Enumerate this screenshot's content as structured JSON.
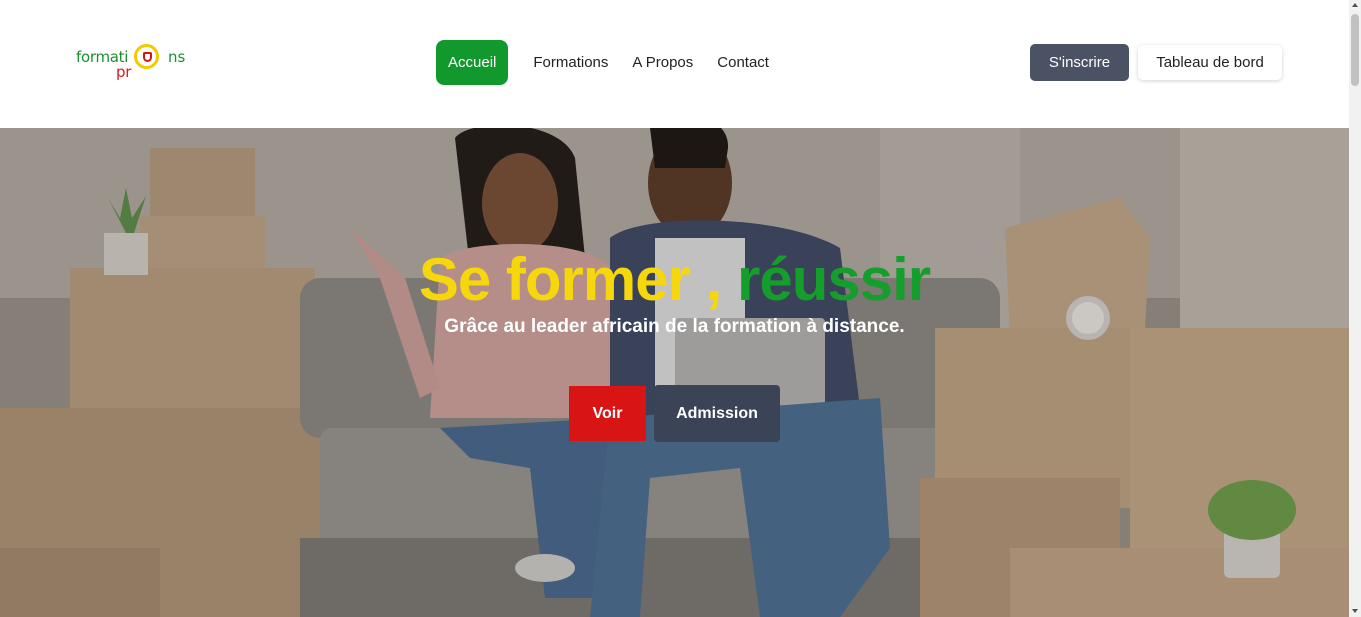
{
  "header": {
    "logo": {
      "line1": "formati",
      "line1_end": "ns",
      "line2": "pr"
    },
    "nav": [
      {
        "label": "Accueil",
        "active": true
      },
      {
        "label": "Formations",
        "active": false
      },
      {
        "label": "A Propos",
        "active": false
      },
      {
        "label": "Contact",
        "active": false
      }
    ],
    "register_label": "S'inscrire",
    "dashboard_label": "Tableau de bord"
  },
  "hero": {
    "title_part1": "Se former ,",
    "title_part2": "réussir",
    "subtitle": "Grâce au leader africain de la formation à distance.",
    "voir_label": "Voir",
    "admission_label": "Admission"
  },
  "colors": {
    "brand_green": "#12992d",
    "brand_yellow": "#f6d70b",
    "brand_red": "#d91414",
    "dark_slate": "#3b4357"
  },
  "icons": [
    "logo-seal-icon"
  ]
}
